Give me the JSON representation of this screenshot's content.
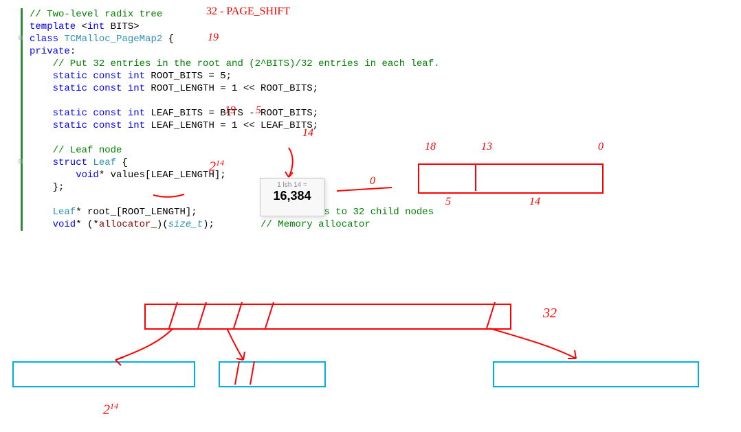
{
  "annotations": {
    "page_shift": "32 - PAGE_SHIFT",
    "nineteen_a": "19",
    "nineteen_b": "19",
    "five": "5",
    "fourteen_a": "14",
    "two_14_a": "2",
    "two_14_a_exp": "14",
    "zero_d": "0",
    "eighteen": "18",
    "thirteen": "13",
    "zero_r": "0",
    "five_b": "5",
    "fourteen_b": "14",
    "thirtytwo": "32",
    "two_14_b": "2",
    "two_14_b_exp": "14"
  },
  "tooltip": {
    "expr": "1 lsh 14 =",
    "result": "16,384"
  },
  "code": {
    "l1_cm": "// Two-level radix tree",
    "l2_kw1": "template",
    "l2_op1": " <",
    "l2_kw2": "int",
    "l2_id": " BITS",
    "l2_op2": ">",
    "l3_kw": "class",
    "l3_tp": " TCMalloc_PageMap2",
    "l3_op": " {",
    "l4_kw": "private",
    "l4_op": ":",
    "l5_cm": "    // Put 32 entries in the root and (2^BITS)/32 entries in each leaf.",
    "l6_kw": "    static const int",
    "l6_id": " ROOT_BITS = 5;",
    "l7_kw": "    static const int",
    "l7_id": " ROOT_LENGTH = 1 << ROOT_BITS;",
    "l8_blank": " ",
    "l9_kw": "    static const int",
    "l9_id": " LEAF_BITS = BITS - ROOT_BITS;",
    "l10_kw": "    static const int",
    "l10_id": " LEAF_LENGTH = 1 << LEAF_BITS;",
    "l11_blank": " ",
    "l12_cm": "    // Leaf node",
    "l13_kw": "    struct",
    "l13_tp": " Leaf",
    "l13_op": " {",
    "l14_kw": "        void",
    "l14_id": "* values[LEAF_LENGTH];",
    "l15_op": "    };",
    "l16_blank": " ",
    "l17_tp": "    Leaf",
    "l17_id": "* root_[ROOT_LENGTH];            ",
    "l17_cm": "// Pointers to 32 child nodes",
    "l18_kw": "    void",
    "l18_id": "* (*",
    "l18_fld": "allocator_",
    "l18_id2": ")(",
    "l18_prm": "size_t",
    "l18_id3": ");        ",
    "l18_cm": "// Memory allocator"
  }
}
